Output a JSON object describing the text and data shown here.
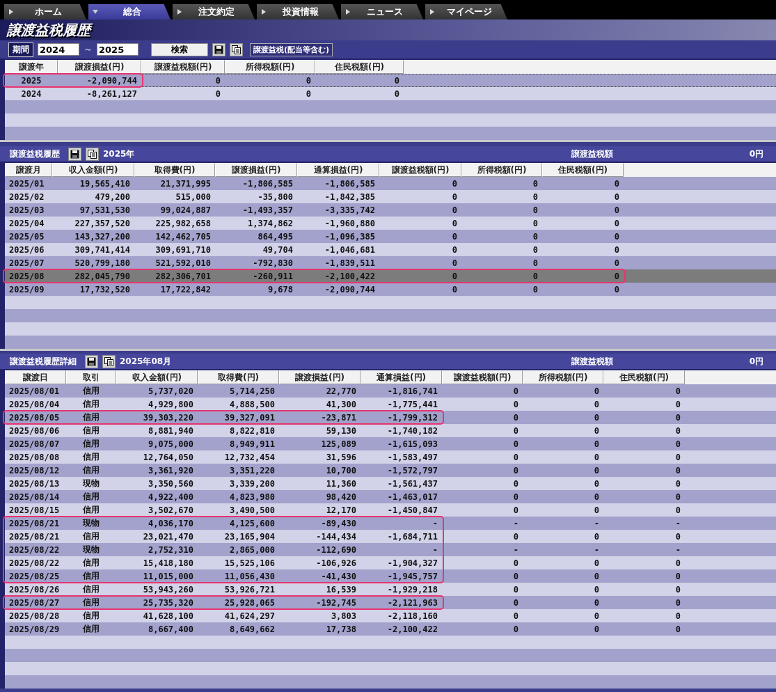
{
  "tabs": [
    {
      "label": "ホーム",
      "selected": false
    },
    {
      "label": "総合",
      "selected": true
    },
    {
      "label": "注文約定",
      "selected": false
    },
    {
      "label": "投資情報",
      "selected": false
    },
    {
      "label": "ニュース",
      "selected": false
    },
    {
      "label": "マイページ",
      "selected": false
    }
  ],
  "page_title": "譲渡益税履歴",
  "filter": {
    "label": "期間",
    "from": "2024",
    "separator": "～",
    "to": "2025",
    "search_button": "検索",
    "mode_button": "譲渡益税(配当等含む)"
  },
  "yearly_table": {
    "columns": [
      "譲渡年",
      "譲渡損益(円)",
      "譲渡益税額(円)",
      "所得税額(円)",
      "住民税額(円)"
    ],
    "rows": [
      {
        "cells": [
          "2025",
          "-2,090,744",
          "0",
          "0",
          "0"
        ],
        "selected": true,
        "marked": true
      },
      {
        "cells": [
          "2024",
          "-8,261,127",
          "0",
          "0",
          "0"
        ],
        "selected": false,
        "marked": false
      }
    ]
  },
  "monthly_section": {
    "title": "譲渡益税履歴",
    "period": "2025年",
    "total_label": "譲渡益税額",
    "total_value": "0円",
    "columns": [
      "譲渡月",
      "収入金額(円)",
      "取得費(円)",
      "譲渡損益(円)",
      "通算損益(円)",
      "譲渡益税額(円)",
      "所得税額(円)",
      "住民税額(円)"
    ],
    "rows": [
      {
        "cells": [
          "2025/01",
          "19,565,410",
          "21,371,995",
          "-1,806,585",
          "-1,806,585",
          "0",
          "0",
          "0"
        ],
        "selected": false,
        "marked": false
      },
      {
        "cells": [
          "2025/02",
          "479,200",
          "515,000",
          "-35,800",
          "-1,842,385",
          "0",
          "0",
          "0"
        ],
        "selected": false,
        "marked": false
      },
      {
        "cells": [
          "2025/03",
          "97,531,530",
          "99,024,887",
          "-1,493,357",
          "-3,335,742",
          "0",
          "0",
          "0"
        ],
        "selected": false,
        "marked": false
      },
      {
        "cells": [
          "2025/04",
          "227,357,520",
          "225,982,658",
          "1,374,862",
          "-1,960,880",
          "0",
          "0",
          "0"
        ],
        "selected": false,
        "marked": false
      },
      {
        "cells": [
          "2025/05",
          "143,327,200",
          "142,462,705",
          "864,495",
          "-1,096,385",
          "0",
          "0",
          "0"
        ],
        "selected": false,
        "marked": false
      },
      {
        "cells": [
          "2025/06",
          "309,741,414",
          "309,691,710",
          "49,704",
          "-1,046,681",
          "0",
          "0",
          "0"
        ],
        "selected": false,
        "marked": false
      },
      {
        "cells": [
          "2025/07",
          "520,799,180",
          "521,592,010",
          "-792,830",
          "-1,839,511",
          "0",
          "0",
          "0"
        ],
        "selected": false,
        "marked": false
      },
      {
        "cells": [
          "2025/08",
          "282,045,790",
          "282,306,701",
          "-260,911",
          "-2,100,422",
          "0",
          "0",
          "0"
        ],
        "selected": true,
        "marked": true
      },
      {
        "cells": [
          "2025/09",
          "17,732,520",
          "17,722,842",
          "9,678",
          "-2,090,744",
          "0",
          "0",
          "0"
        ],
        "selected": false,
        "marked": false
      }
    ]
  },
  "detail_section": {
    "title": "譲渡益税履歴詳細",
    "period": "2025年08月",
    "total_label": "譲渡益税額",
    "total_value": "0円",
    "columns": [
      "譲渡日",
      "取引",
      "収入金額(円)",
      "取得費(円)",
      "譲渡損益(円)",
      "通算損益(円)",
      "譲渡益税額(円)",
      "所得税額(円)",
      "住民税額(円)"
    ],
    "rows": [
      {
        "cells": [
          "2025/08/01",
          "信用",
          "5,737,020",
          "5,714,250",
          "22,770",
          "-1,816,741",
          "0",
          "0",
          "0"
        ],
        "marked": false
      },
      {
        "cells": [
          "2025/08/04",
          "信用",
          "4,929,800",
          "4,888,500",
          "41,300",
          "-1,775,441",
          "0",
          "0",
          "0"
        ],
        "marked": false
      },
      {
        "cells": [
          "2025/08/05",
          "信用",
          "39,303,220",
          "39,327,091",
          "-23,871",
          "-1,799,312",
          "0",
          "0",
          "0"
        ],
        "marked": true
      },
      {
        "cells": [
          "2025/08/06",
          "信用",
          "8,881,940",
          "8,822,810",
          "59,130",
          "-1,740,182",
          "0",
          "0",
          "0"
        ],
        "marked": false
      },
      {
        "cells": [
          "2025/08/07",
          "信用",
          "9,075,000",
          "8,949,911",
          "125,089",
          "-1,615,093",
          "0",
          "0",
          "0"
        ],
        "marked": false
      },
      {
        "cells": [
          "2025/08/08",
          "信用",
          "12,764,050",
          "12,732,454",
          "31,596",
          "-1,583,497",
          "0",
          "0",
          "0"
        ],
        "marked": false
      },
      {
        "cells": [
          "2025/08/12",
          "信用",
          "3,361,920",
          "3,351,220",
          "10,700",
          "-1,572,797",
          "0",
          "0",
          "0"
        ],
        "marked": false
      },
      {
        "cells": [
          "2025/08/13",
          "現物",
          "3,350,560",
          "3,339,200",
          "11,360",
          "-1,561,437",
          "0",
          "0",
          "0"
        ],
        "marked": false
      },
      {
        "cells": [
          "2025/08/14",
          "信用",
          "4,922,400",
          "4,823,980",
          "98,420",
          "-1,463,017",
          "0",
          "0",
          "0"
        ],
        "marked": false
      },
      {
        "cells": [
          "2025/08/15",
          "信用",
          "3,502,670",
          "3,490,500",
          "12,170",
          "-1,450,847",
          "0",
          "0",
          "0"
        ],
        "marked": false
      },
      {
        "cells": [
          "2025/08/21",
          "現物",
          "4,036,170",
          "4,125,600",
          "-89,430",
          "-",
          "-",
          "-",
          "-"
        ],
        "marked": true
      },
      {
        "cells": [
          "2025/08/21",
          "信用",
          "23,021,470",
          "23,165,904",
          "-144,434",
          "-1,684,711",
          "0",
          "0",
          "0"
        ],
        "marked": true
      },
      {
        "cells": [
          "2025/08/22",
          "現物",
          "2,752,310",
          "2,865,000",
          "-112,690",
          "-",
          "-",
          "-",
          "-"
        ],
        "marked": true
      },
      {
        "cells": [
          "2025/08/22",
          "信用",
          "15,418,180",
          "15,525,106",
          "-106,926",
          "-1,904,327",
          "0",
          "0",
          "0"
        ],
        "marked": true
      },
      {
        "cells": [
          "2025/08/25",
          "信用",
          "11,015,000",
          "11,056,430",
          "-41,430",
          "-1,945,757",
          "0",
          "0",
          "0"
        ],
        "marked": true
      },
      {
        "cells": [
          "2025/08/26",
          "信用",
          "53,943,260",
          "53,926,721",
          "16,539",
          "-1,929,218",
          "0",
          "0",
          "0"
        ],
        "marked": false
      },
      {
        "cells": [
          "2025/08/27",
          "信用",
          "25,735,320",
          "25,928,065",
          "-192,745",
          "-2,121,963",
          "0",
          "0",
          "0"
        ],
        "marked": true
      },
      {
        "cells": [
          "2025/08/28",
          "信用",
          "41,628,100",
          "41,624,297",
          "3,803",
          "-2,118,160",
          "0",
          "0",
          "0"
        ],
        "marked": false
      },
      {
        "cells": [
          "2025/08/29",
          "信用",
          "8,667,400",
          "8,649,662",
          "17,738",
          "-2,100,422",
          "0",
          "0",
          "0"
        ],
        "marked": false
      }
    ]
  }
}
